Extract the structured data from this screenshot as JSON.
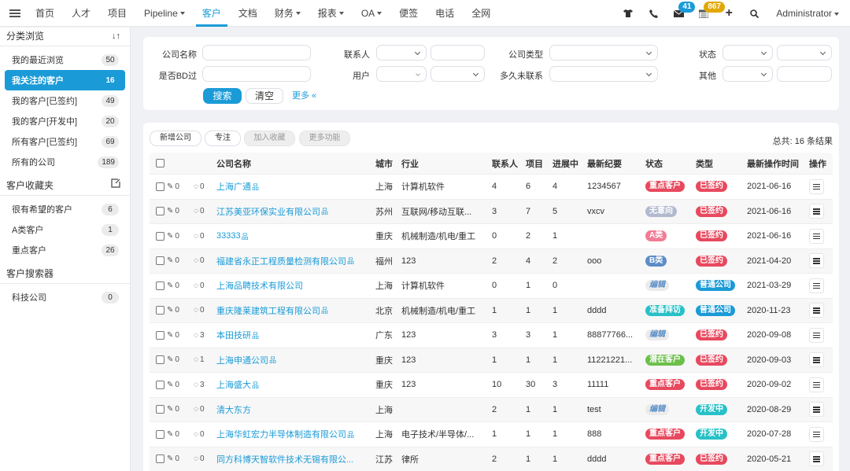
{
  "topnav": {
    "items": [
      {
        "label": "首页",
        "dropdown": false,
        "active": false
      },
      {
        "label": "人才",
        "dropdown": false,
        "active": false
      },
      {
        "label": "项目",
        "dropdown": false,
        "active": false
      },
      {
        "label": "Pipeline",
        "dropdown": true,
        "active": false
      },
      {
        "label": "客户",
        "dropdown": false,
        "active": true
      },
      {
        "label": "文档",
        "dropdown": false,
        "active": false
      },
      {
        "label": "财务",
        "dropdown": true,
        "active": false
      },
      {
        "label": "报表",
        "dropdown": true,
        "active": false
      },
      {
        "label": "OA",
        "dropdown": true,
        "active": false
      },
      {
        "label": "便签",
        "dropdown": false,
        "active": false
      },
      {
        "label": "电话",
        "dropdown": false,
        "active": false
      },
      {
        "label": "全网",
        "dropdown": false,
        "active": false
      }
    ],
    "right": {
      "mail_badge": "41",
      "calendar_badge": "867",
      "mail_badge_color": "#1a9bd7",
      "calendar_badge_color": "#e0a800",
      "user": "Administrator"
    }
  },
  "sidebar": {
    "browse_title": "分类浏览",
    "browse_items": [
      {
        "label": "我的最近浏览",
        "count": "50",
        "active": false
      },
      {
        "label": "我关注的客户",
        "count": "16",
        "active": true
      },
      {
        "label": "我的客户[已签约]",
        "count": "49",
        "active": false
      },
      {
        "label": "我的客户[开发中]",
        "count": "20",
        "active": false
      },
      {
        "label": "所有客户[已签约]",
        "count": "69",
        "active": false
      },
      {
        "label": "所有的公司",
        "count": "189",
        "active": false
      }
    ],
    "favorites_title": "客户收藏夹",
    "favorites_items": [
      {
        "label": "很有希望的客户",
        "count": "6"
      },
      {
        "label": "A类客户",
        "count": "1"
      },
      {
        "label": "重点客户",
        "count": "26"
      }
    ],
    "searcher_title": "客户搜索器",
    "searcher_items": [
      {
        "label": "科技公司",
        "count": "0"
      }
    ]
  },
  "search": {
    "labels": {
      "company_name": "公司名称",
      "bd": "是否BD过",
      "contact": "联系人",
      "user": "用户",
      "company_type": "公司类型",
      "not_contacted": "多久未联系",
      "status": "状态",
      "other": "其他"
    },
    "values": {
      "company_name": "",
      "bd": "",
      "contact_select": "",
      "contact_input": "",
      "user_select_1": "",
      "user_select_2": "",
      "company_type": "",
      "not_contacted": "",
      "status_1": "",
      "status_2": "",
      "other_select": "",
      "other_input": ""
    },
    "search_button": "搜索",
    "clear_button": "清空",
    "more_link": "更多 «"
  },
  "toolbar": {
    "add_company": "新增公司",
    "focus": "专注",
    "add_favorite": "加入收藏",
    "more_functions": "更多功能",
    "total": "总共: 16 条结果"
  },
  "table": {
    "headers": {
      "company": "公司名称",
      "city": "城市",
      "industry": "行业",
      "contacts": "联系人",
      "projects": "项目",
      "in_progress": "进展中",
      "latest_note": "最新纪要",
      "status": "状态",
      "type": "类型",
      "last_op_time": "最新操作时间",
      "actions": "操作"
    },
    "rows": [
      {
        "attachments": "0",
        "comments": "0",
        "company": "上海广通",
        "org": true,
        "city": "上海",
        "industry": "计算机软件",
        "contacts": "4",
        "projects": "6",
        "in_progress": "4",
        "latest_note": "1234567",
        "status": "重点客户",
        "status_color": "#e8495e",
        "type": "已签约",
        "type_color": "#e8495e",
        "last_op_time": "2021-06-16"
      },
      {
        "attachments": "0",
        "comments": "0",
        "company": "江苏美亚环保实业有限公司",
        "org": true,
        "city": "苏州",
        "industry": "互联网/移动互联...",
        "contacts": "3",
        "projects": "7",
        "in_progress": "5",
        "latest_note": "vxcv",
        "status": "无意向",
        "status_color": "#b2b9cf",
        "type": "已签约",
        "type_color": "#e8495e",
        "last_op_time": "2021-06-16"
      },
      {
        "attachments": "0",
        "comments": "0",
        "company": "33333",
        "org": true,
        "city": "重庆",
        "industry": "机械制造/机电/重工",
        "contacts": "0",
        "projects": "2",
        "in_progress": "1",
        "latest_note": "",
        "status": "A类",
        "status_color": "#f27b95",
        "type": "已签约",
        "type_color": "#e8495e",
        "last_op_time": "2021-06-16"
      },
      {
        "attachments": "0",
        "comments": "0",
        "company": "福建省永正工程质量检测有限公司",
        "org": true,
        "city": "福州",
        "industry": "123",
        "contacts": "2",
        "projects": "4",
        "in_progress": "2",
        "latest_note": "ooo",
        "status": "B类",
        "status_color": "#5c8dc7",
        "type": "已签约",
        "type_color": "#e8495e",
        "last_op_time": "2021-04-20"
      },
      {
        "attachments": "0",
        "comments": "0",
        "company": "上海品聘技术有限公司",
        "org": false,
        "city": "上海",
        "industry": "计算机软件",
        "contacts": "0",
        "projects": "1",
        "in_progress": "0",
        "latest_note": "",
        "status": "编辑",
        "status_color": "edit",
        "type": "普通公司",
        "type_color": "#1a9bd7",
        "last_op_time": "2021-03-29"
      },
      {
        "attachments": "0",
        "comments": "0",
        "company": "重庆隆莱建筑工程有限公司",
        "org": true,
        "city": "北京",
        "industry": "机械制造/机电/重工",
        "contacts": "1",
        "projects": "1",
        "in_progress": "1",
        "latest_note": "dddd",
        "status": "准备拜访",
        "status_color": "#27c1c7",
        "type": "普通公司",
        "type_color": "#1a9bd7",
        "last_op_time": "2020-11-23"
      },
      {
        "attachments": "0",
        "comments": "3",
        "company": "本田技研",
        "org": true,
        "city": "广东",
        "industry": "123",
        "contacts": "3",
        "projects": "3",
        "in_progress": "1",
        "latest_note": "88877766...",
        "status": "编辑",
        "status_color": "edit",
        "type": "已签约",
        "type_color": "#e8495e",
        "last_op_time": "2020-09-08"
      },
      {
        "attachments": "0",
        "comments": "1",
        "company": "上海申通公司",
        "org": true,
        "city": "重庆",
        "industry": "123",
        "contacts": "1",
        "projects": "1",
        "in_progress": "1",
        "latest_note": "11221221...",
        "status": "潜在客户",
        "status_color": "#6cc04a",
        "type": "已签约",
        "type_color": "#e8495e",
        "last_op_time": "2020-09-03"
      },
      {
        "attachments": "0",
        "comments": "3",
        "company": "上海盛大",
        "org": true,
        "city": "重庆",
        "industry": "123",
        "contacts": "10",
        "projects": "30",
        "in_progress": "3",
        "latest_note": "11111",
        "status": "重点客户",
        "status_color": "#e8495e",
        "type": "已签约",
        "type_color": "#e8495e",
        "last_op_time": "2020-09-02"
      },
      {
        "attachments": "0",
        "comments": "0",
        "company": "清大东方",
        "org": false,
        "city": "上海",
        "industry": "",
        "contacts": "2",
        "projects": "1",
        "in_progress": "1",
        "latest_note": "test",
        "status": "编辑",
        "status_color": "edit",
        "type": "开发中",
        "type_color": "#27c1c7",
        "last_op_time": "2020-08-29"
      },
      {
        "attachments": "0",
        "comments": "0",
        "company": "上海华虹宏力半导体制造有限公司",
        "org": true,
        "city": "上海",
        "industry": "电子技术/半导体/...",
        "contacts": "1",
        "projects": "1",
        "in_progress": "1",
        "latest_note": "888",
        "status": "重点客户",
        "status_color": "#e8495e",
        "type": "开发中",
        "type_color": "#27c1c7",
        "last_op_time": "2020-07-28"
      },
      {
        "attachments": "0",
        "comments": "0",
        "company": "同方科博天智软件技术无锡有限公...",
        "org": false,
        "city": "江苏",
        "industry": "律所",
        "contacts": "2",
        "projects": "1",
        "in_progress": "1",
        "latest_note": "dddd",
        "status": "重点客户",
        "status_color": "#e8495e",
        "type": "已签约",
        "type_color": "#e8495e",
        "last_op_time": "2020-05-21"
      }
    ]
  }
}
